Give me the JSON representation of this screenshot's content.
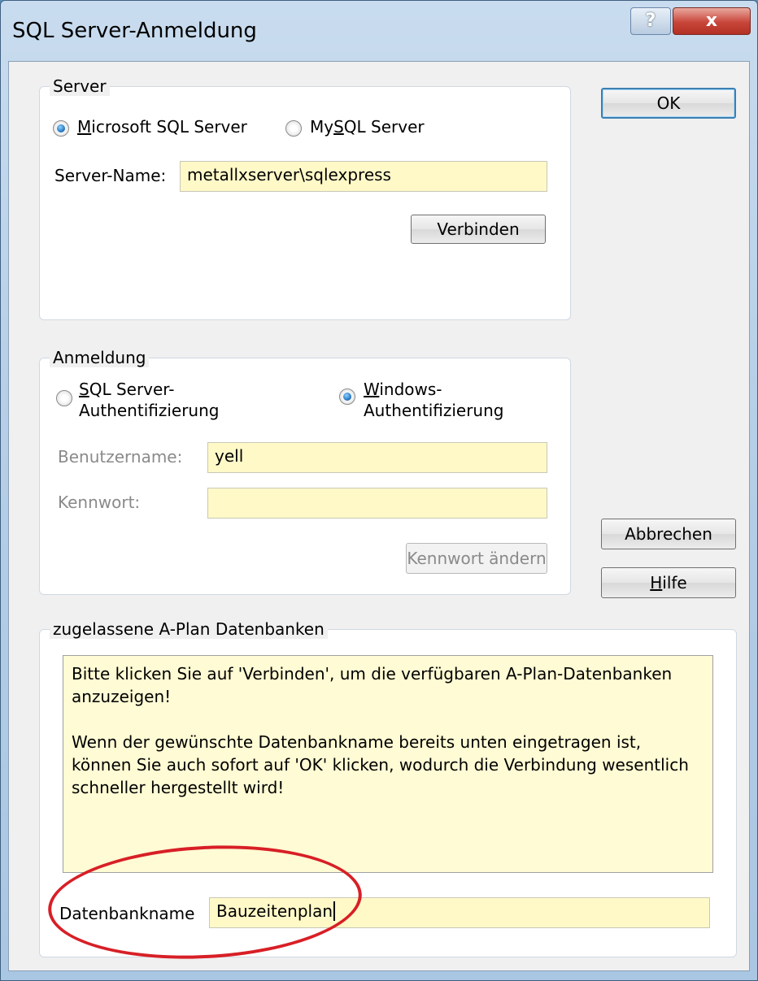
{
  "window": {
    "title": "SQL Server-Anmeldung",
    "help_button": "?",
    "close_button": "x"
  },
  "server_group": {
    "legend": "Server",
    "radio_mssql": {
      "mnemonic": "M",
      "rest": "icrosoft SQL Server",
      "selected": true
    },
    "radio_mysql": {
      "pre": "My",
      "mnemonic": "S",
      "rest": "QL Server",
      "selected": false
    },
    "server_name_label": "Server-Name:",
    "server_name_value": "metallxserver\\sqlexpress",
    "connect_button": "Verbinden"
  },
  "login_group": {
    "legend": "Anmeldung",
    "radio_sql": {
      "mnemonic": "S",
      "line1_rest": "QL Server-",
      "line2": "Authentifizierung",
      "selected": false
    },
    "radio_windows": {
      "mnemonic": "W",
      "line1_rest": "indows-",
      "line2": "Authentifizierung",
      "selected": true
    },
    "username_label": "Benutzername:",
    "username_value": "yell",
    "password_label": "Kennwort:",
    "password_value": "",
    "change_password_button": "Kennwort ändern"
  },
  "databases_group": {
    "legend": "zugelassene A-Plan Datenbanken",
    "info_paragraph_1": "Bitte klicken Sie auf 'Verbinden', um die verfügbaren A-Plan-Datenbanken anzuzeigen!",
    "info_paragraph_2": "Wenn der gewünschte Datenbankname bereits unten eingetragen ist, können Sie auch sofort auf 'OK' klicken, wodurch die Verbindung wesentlich schneller hergestellt wird!",
    "db_name_label": "Datenbankname",
    "db_name_value": "Bauzeitenplan"
  },
  "buttons": {
    "ok": "OK",
    "cancel": "Abbrechen",
    "help_mnemonic": "H",
    "help_rest": "ilfe"
  },
  "colors": {
    "input_bg": "#fff9c8",
    "annotation_ellipse": "#d81f26"
  }
}
